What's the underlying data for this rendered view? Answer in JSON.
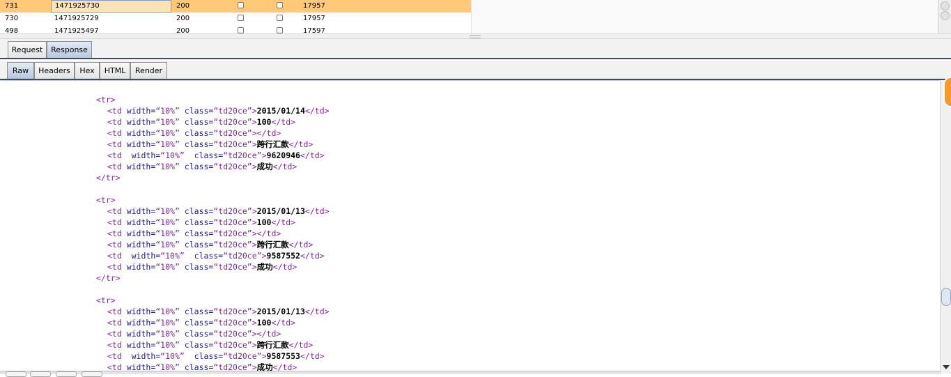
{
  "results": {
    "rows": [
      {
        "id": "731",
        "payload": "1471925730",
        "status": "200",
        "length": "17957",
        "selected": true
      },
      {
        "id": "730",
        "payload": "1471925729",
        "status": "200",
        "length": "17957",
        "selected": false
      },
      {
        "id": "498",
        "payload": "1471925497",
        "status": "200",
        "length": "17597",
        "selected": false
      }
    ]
  },
  "message_tabs": [
    {
      "label": "Request",
      "active": false
    },
    {
      "label": "Response",
      "active": true
    }
  ],
  "view_tabs": [
    {
      "label": "Raw",
      "active": true
    },
    {
      "label": "Headers",
      "active": false
    },
    {
      "label": "Hex",
      "active": false
    },
    {
      "label": "HTML",
      "active": false
    },
    {
      "label": "Render",
      "active": false
    }
  ],
  "code": {
    "blocks": [
      {
        "cells": [
          {
            "attrs": "width=“10%” class=“td20ce”",
            "text": "2015/01/14"
          },
          {
            "attrs": "width=“10%” class=“td20ce”",
            "text": "100"
          },
          {
            "attrs": "width=“10%” class=“td20ce”",
            "text": ""
          },
          {
            "attrs": "width=“10%” class=“td20ce”",
            "text": "跨行汇款"
          },
          {
            "attrs": " width=“10%”  class=“td20ce”",
            "text": "9620946"
          },
          {
            "attrs": "width=“10%” class=“td20ce”",
            "text": "成功"
          }
        ]
      },
      {
        "cells": [
          {
            "attrs": "width=“10%” class=“td20ce”",
            "text": "2015/01/13"
          },
          {
            "attrs": "width=“10%” class=“td20ce”",
            "text": "100"
          },
          {
            "attrs": "width=“10%” class=“td20ce”",
            "text": ""
          },
          {
            "attrs": "width=“10%” class=“td20ce”",
            "text": "跨行汇款"
          },
          {
            "attrs": " width=“10%”  class=“td20ce”",
            "text": "9587552"
          },
          {
            "attrs": "width=“10%” class=“td20ce”",
            "text": "成功"
          }
        ]
      },
      {
        "cells": [
          {
            "attrs": "width=“10%” class=“td20ce”",
            "text": "2015/01/13"
          },
          {
            "attrs": "width=“10%” class=“td20ce”",
            "text": "100"
          },
          {
            "attrs": "width=“10%” class=“td20ce”",
            "text": ""
          },
          {
            "attrs": "width=“10%” class=“td20ce”",
            "text": "跨行汇款"
          },
          {
            "attrs": " width=“10%”  class=“td20ce”",
            "text": "9587553"
          },
          {
            "attrs": "width=“10%” class=“td20ce”",
            "text": "成功"
          }
        ]
      }
    ]
  },
  "colors": {
    "selected_row": "#ffc977",
    "tag": "#7d2a8f",
    "attribute": "#1f1b8a",
    "tab_active": "#b7c8de",
    "accent_orange": "#f39b2a"
  }
}
